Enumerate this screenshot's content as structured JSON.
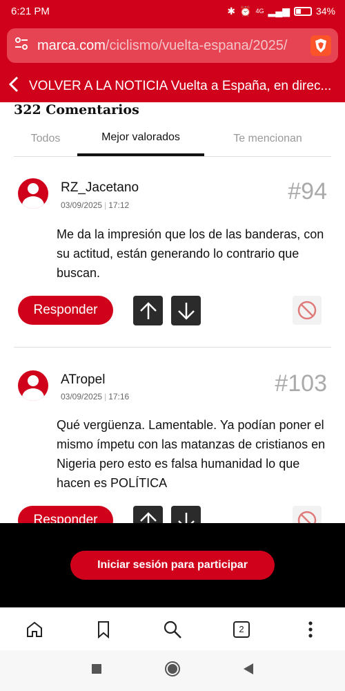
{
  "status_bar": {
    "time": "6:21 PM",
    "battery": "34%",
    "network": "4G"
  },
  "browser": {
    "url_domain": "marca.com",
    "url_path": "/ciclismo/vuelta-espana/2025/"
  },
  "header": {
    "back_text": "VOLVER A LA NOTICIA Vuelta a España, en direc..."
  },
  "comments": {
    "title": "322 Comentarios",
    "tabs": [
      {
        "label": "Todos"
      },
      {
        "label": "Mejor valorados"
      },
      {
        "label": "Te mencionan"
      }
    ],
    "items": [
      {
        "user": "RZ_Jacetano",
        "date": "03/09/2025",
        "time": "17:12",
        "number": "#94",
        "text": "Me da la impresión que los de las banderas, con su actitud, están generando lo contrario que buscan.",
        "reply_label": "Responder"
      },
      {
        "user": "ATropel",
        "date": "03/09/2025",
        "time": "17:16",
        "number": "#103",
        "text": "Qué vergüenza. Lamentable. Ya podían poner el mismo ímpetu con las matanzas de cristianos en Nigeria pero esto es falsa humanidad lo que hacen es POLÍTICA",
        "reply_label": "Responder"
      }
    ]
  },
  "login": {
    "label": "Iniciar sesión para participar"
  },
  "bottom_nav": {
    "tabs_count": "2"
  },
  "colors": {
    "brand_red": "#d0021b",
    "vote_bg": "#2b2b2b"
  }
}
